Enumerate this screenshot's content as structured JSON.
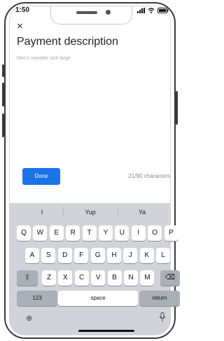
{
  "status": {
    "time": "1:50",
    "icons": "■■■ ◉ ▬"
  },
  "header": {
    "close_label": "×",
    "title": "Payment description"
  },
  "description": {
    "placeholder": "Men's sweater size large"
  },
  "actions": {
    "done_label": "Done",
    "counter": "21/90 characters"
  },
  "keyboard": {
    "suggestions": [
      "I",
      "Yup",
      "Ya"
    ],
    "row1": [
      "Q",
      "W",
      "E",
      "R",
      "T",
      "Y",
      "U",
      "I",
      "O",
      "P"
    ],
    "row2": [
      "A",
      "S",
      "D",
      "F",
      "G",
      "H",
      "J",
      "K",
      "L"
    ],
    "row3": [
      "Z",
      "X",
      "C",
      "V",
      "B",
      "N",
      "M"
    ],
    "numbers_label": "123",
    "space_label": "space",
    "return_label": "return",
    "shift_icon": "⇧",
    "backspace_icon": "⌫",
    "globe_icon": "⊕"
  }
}
